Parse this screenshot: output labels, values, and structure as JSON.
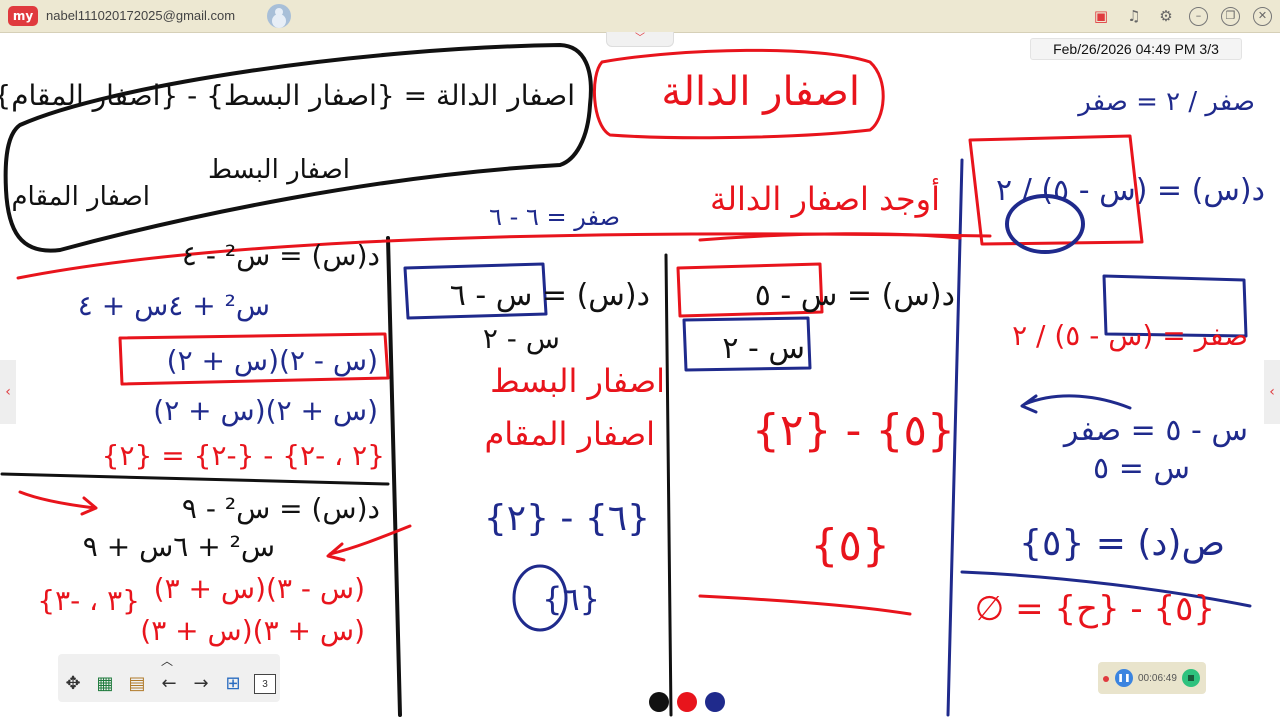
{
  "app": {
    "logo_text": "my",
    "account_email": "nabel111020172025@gmail.com"
  },
  "toolbar_icons": [
    "cast-icon",
    "bell-icon",
    "gear-icon",
    "minimize-icon",
    "restore-icon",
    "close-icon"
  ],
  "status": {
    "datetime": "Feb/26/2026 04:49 PM",
    "page": "3/3"
  },
  "board": {
    "top_title_arabic": "اصفار الدالة",
    "def_zeros": "اصفار الدالة = {اصفار البسط} - {اصفار المقام}",
    "label_numerator_zeros": "اصفار البسط",
    "label_denominator_zeros": "اصفار المقام",
    "label_find_zeros": "أوجد اصفار الدالة",
    "panel1": {
      "line1": "د(س) = س² - ٤",
      "line2": "س² + ٤س + ٤",
      "factors_num": "(س - ٢)(س + ٢)",
      "factors_den": "(س + ٢)(س + ٢)",
      "result1": "{٢ ، -٢} - {-٢} = {٢}",
      "line3": "د(س) = س² - ٩",
      "line3_den": "س² + ٦س + ٩",
      "factors2": "(س - ٣)(س + ٣)",
      "factors2_den": "(س + ٣)(س + ٣)",
      "result2": "{٣ ، -٣}"
    },
    "panel2": {
      "fn": "د(س) = س - ٦",
      "den": "س - ٢",
      "note": "صفر = ٦ - ٦",
      "result": "{٦} - {٢}",
      "answer": "{٦}"
    },
    "panel3": {
      "fn": "د(س) = س - ٥",
      "den": "س - ٢",
      "result": "{٥} - {٢}",
      "answer": "{٥}"
    },
    "panel4": {
      "fn": "د(س) = (س - ٥) / ٢",
      "zero_eq": "صفر = (س - ٥) / ٢",
      "step": "س - ٥ = صفر",
      "sol": "س = ٥",
      "answer": "ص(د) = {٥}",
      "final": "{٥} - {ح} = ∅",
      "corner": "صفر / ٢ = صفر"
    }
  },
  "page_counter": "3",
  "pen_colors": [
    "#111111",
    "#e8141c",
    "#1f2a8c"
  ],
  "recorder": {
    "time": "00:06:49"
  }
}
